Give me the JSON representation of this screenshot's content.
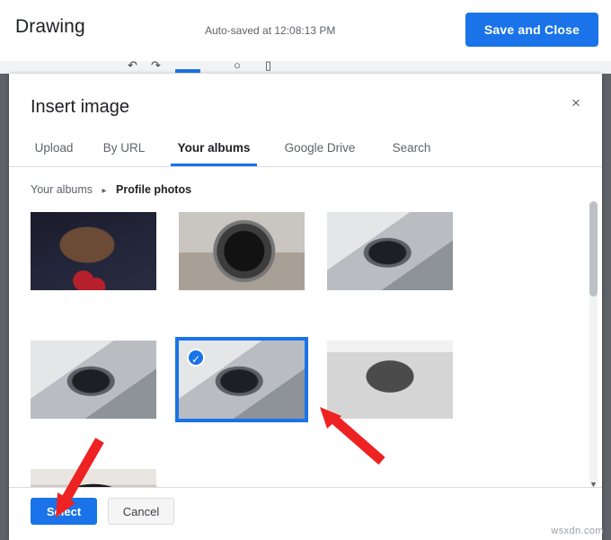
{
  "top_bar": {
    "title": "Drawing",
    "autosave_text": "Auto-saved at 12:08:13 PM",
    "save_close_label": "Save and Close"
  },
  "dialog": {
    "title": "Insert image",
    "close_icon": "×",
    "tabs": [
      {
        "label": "Upload",
        "active": false
      },
      {
        "label": "By URL",
        "active": false
      },
      {
        "label": "Your albums",
        "active": true
      },
      {
        "label": "Google Drive",
        "active": false
      },
      {
        "label": "Search",
        "active": false
      }
    ],
    "breadcrumb": {
      "root": "Your albums",
      "separator": "▸",
      "current": "Profile photos"
    },
    "thumbnails": [
      {
        "name": "thumb-portrait-woman-red-necklace",
        "selected": false
      },
      {
        "name": "thumb-car-wheel",
        "selected": false
      },
      {
        "name": "thumb-headlight-a",
        "selected": false
      },
      {
        "name": "thumb-headlight-b",
        "selected": false
      },
      {
        "name": "thumb-headlight-selected",
        "selected": true
      },
      {
        "name": "thumb-portrait-bw",
        "selected": false
      },
      {
        "name": "thumb-hair-partial",
        "selected": false
      }
    ],
    "selected_badge_icon": "✓",
    "footer": {
      "select_label": "Select",
      "cancel_label": "Cancel"
    }
  },
  "annotations": {
    "arrow_color": "#ee2222",
    "arrow_1_target": "selected-thumbnail",
    "arrow_2_target": "select-button"
  },
  "watermark": "wsxdn.com",
  "colors": {
    "accent_blue": "#1a73e8",
    "text_primary": "#202124",
    "text_secondary": "#5f6368",
    "backdrop_grey": "#5f6368",
    "border_grey": "#dadce0"
  }
}
